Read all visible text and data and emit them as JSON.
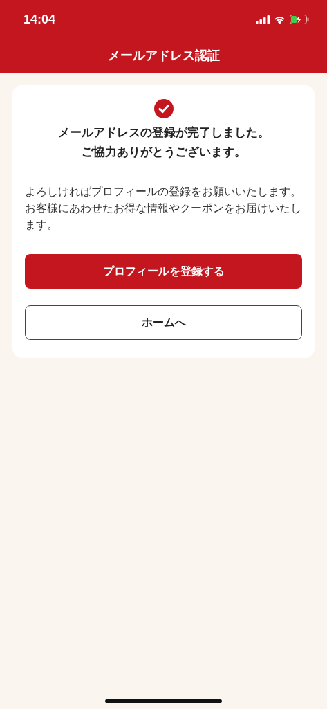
{
  "status_bar": {
    "time": "14:04"
  },
  "header": {
    "title": "メールアドレス認証"
  },
  "card": {
    "heading_lines": [
      "メールアドレスの登録が完了しました。",
      "ご協力ありがとうございます。"
    ],
    "message": "よろしければプロフィールの登録をお願いいたします。お客様にあわせたお得な情報やクーポンをお届けいたします。",
    "buttons": [
      {
        "label": "プロフィールを登録する",
        "kind": "primary"
      },
      {
        "label": "ホームへ",
        "kind": "secondary"
      }
    ]
  }
}
